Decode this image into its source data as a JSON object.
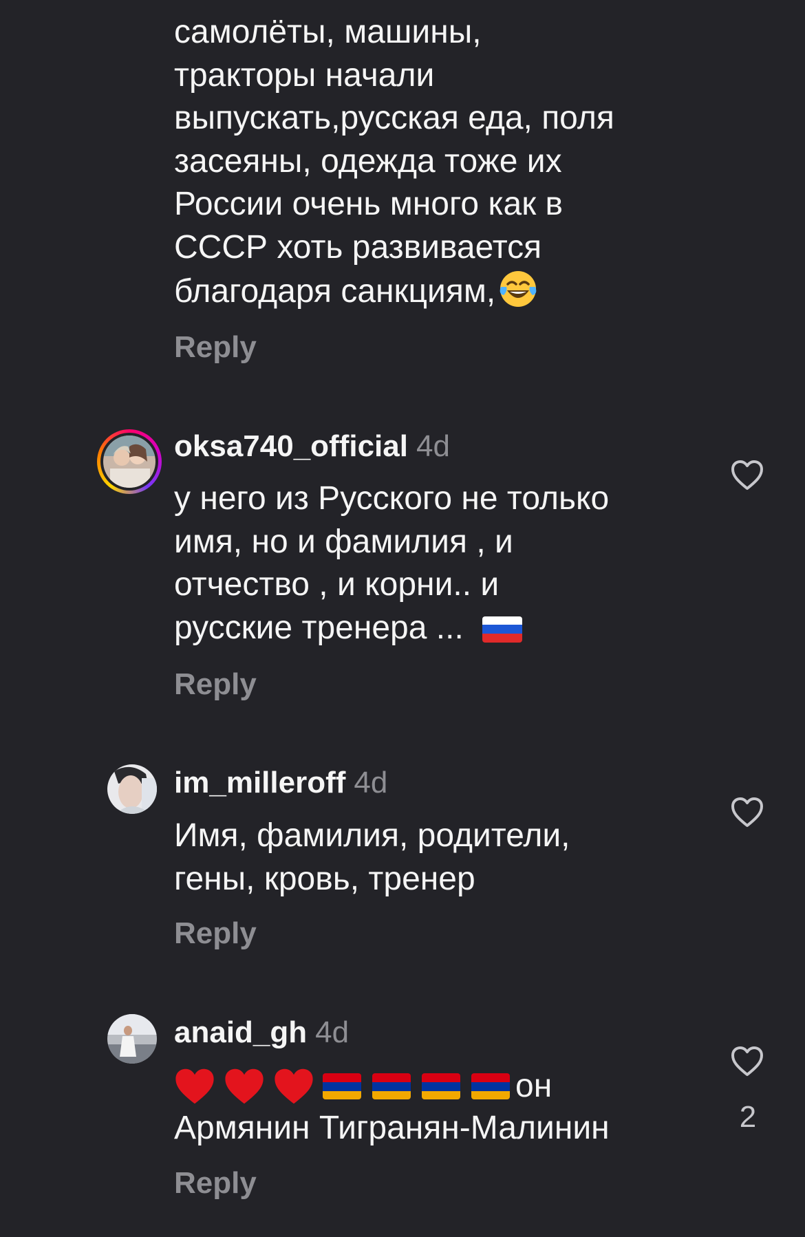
{
  "top_comment": {
    "lines": [
      "самолёты, машины,",
      "тракторы начали",
      "выпускать,русская еда, поля",
      "засеяны, одежда тоже их",
      "России очень много как в",
      "СССР хоть развивается",
      "благодаря санкциям,"
    ],
    "emoji": "laughing-with-tears",
    "reply_label": "Reply"
  },
  "comments": [
    {
      "username": "oksa740_official",
      "time": "4d",
      "has_story_ring": true,
      "lines": [
        "у него из Русского не только",
        "имя, но и фамилия , и",
        "отчество ,  и корни.. и",
        "русские тренера ..."
      ],
      "trailing_emoji": "russia-flag",
      "reply_label": "Reply"
    },
    {
      "username": "im_milleroff",
      "time": "4d",
      "has_story_ring": false,
      "lines": [
        "Имя, фамилия, родители,",
        "гены, кровь, тренер"
      ],
      "reply_label": "Reply"
    },
    {
      "username": "anaid_gh",
      "time": "4d",
      "has_story_ring": false,
      "emoji_prefix": [
        "red-heart",
        "red-heart",
        "red-heart",
        "armenia-flag",
        "armenia-flag",
        "armenia-flag",
        "armenia-flag"
      ],
      "lines": [
        "он",
        "Армянин Тигранян-Малинин"
      ],
      "like_count": "2",
      "reply_label": "Reply"
    }
  ],
  "colors": {
    "background": "#232328",
    "text": "#f5f5f5",
    "muted": "#8e8e93"
  }
}
